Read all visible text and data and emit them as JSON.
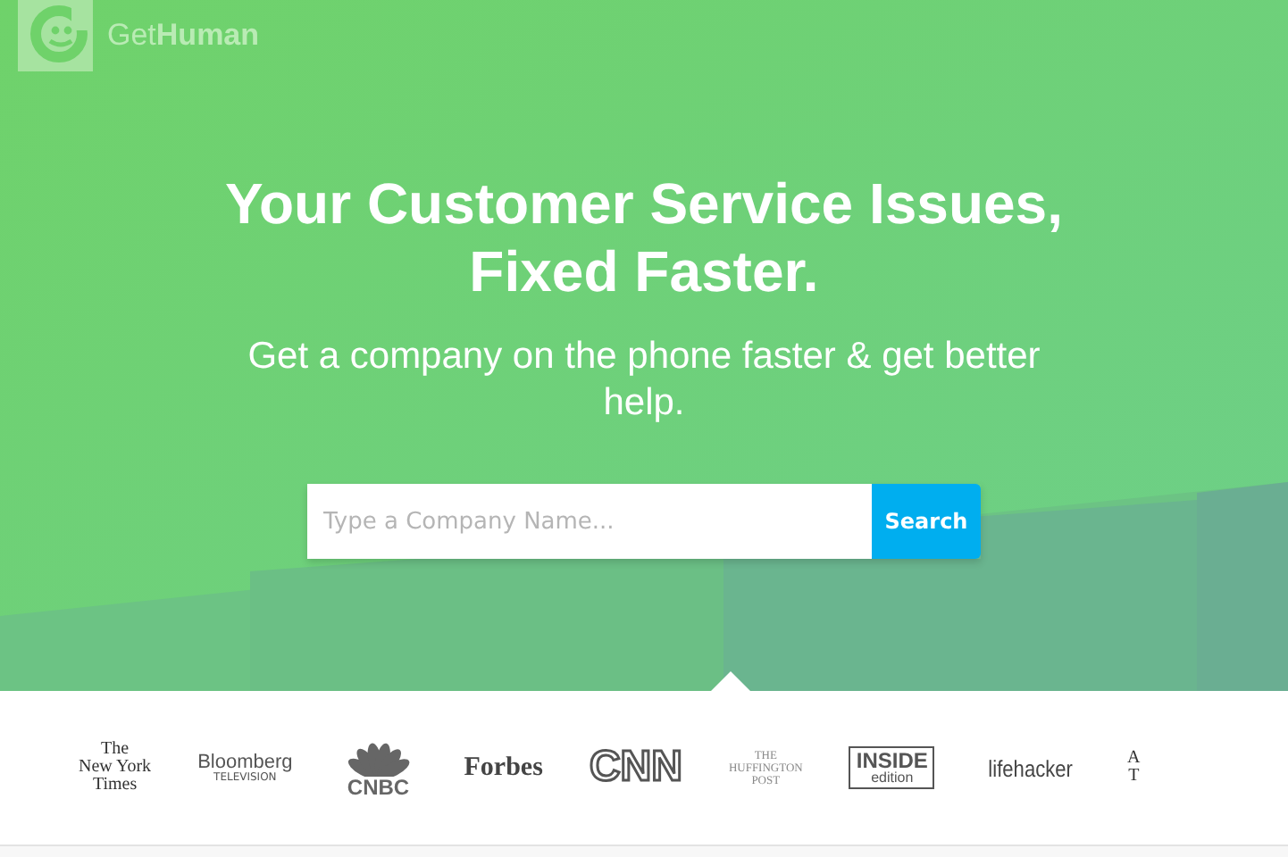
{
  "brand": {
    "name": "Get**Human**"
  },
  "hero": {
    "title_lines": [
      "Your Customer Service Issues,",
      "Fixed Faster."
    ],
    "subtitle": "Get a company on the phone faster & get better help."
  },
  "search": {
    "placeholder": "Type a Company Name...",
    "button": "Search"
  },
  "press_logos": [
    {
      "kind": "blackletter",
      "lines": [
        "The",
        "New York",
        "Times"
      ]
    },
    {
      "kind": "sans-caption",
      "lines": [
        "Bloomberg",
        "TELEVISION"
      ]
    },
    {
      "kind": "peacock",
      "lines": [
        "CNBC"
      ]
    },
    {
      "kind": "serif-bold",
      "lines": [
        "Forbes"
      ]
    },
    {
      "kind": "outline",
      "lines": [
        "CNN"
      ]
    },
    {
      "kind": "serif-small",
      "lines": [
        "THE",
        "HUFFINGTON",
        "POST"
      ]
    },
    {
      "kind": "boxed",
      "lines": [
        "INSIDE",
        "edition"
      ]
    },
    {
      "kind": "condensed",
      "lines": [
        "lifehacker"
      ]
    },
    {
      "kind": "blackletter",
      "lines": [
        "A",
        "T"
      ]
    }
  ]
}
